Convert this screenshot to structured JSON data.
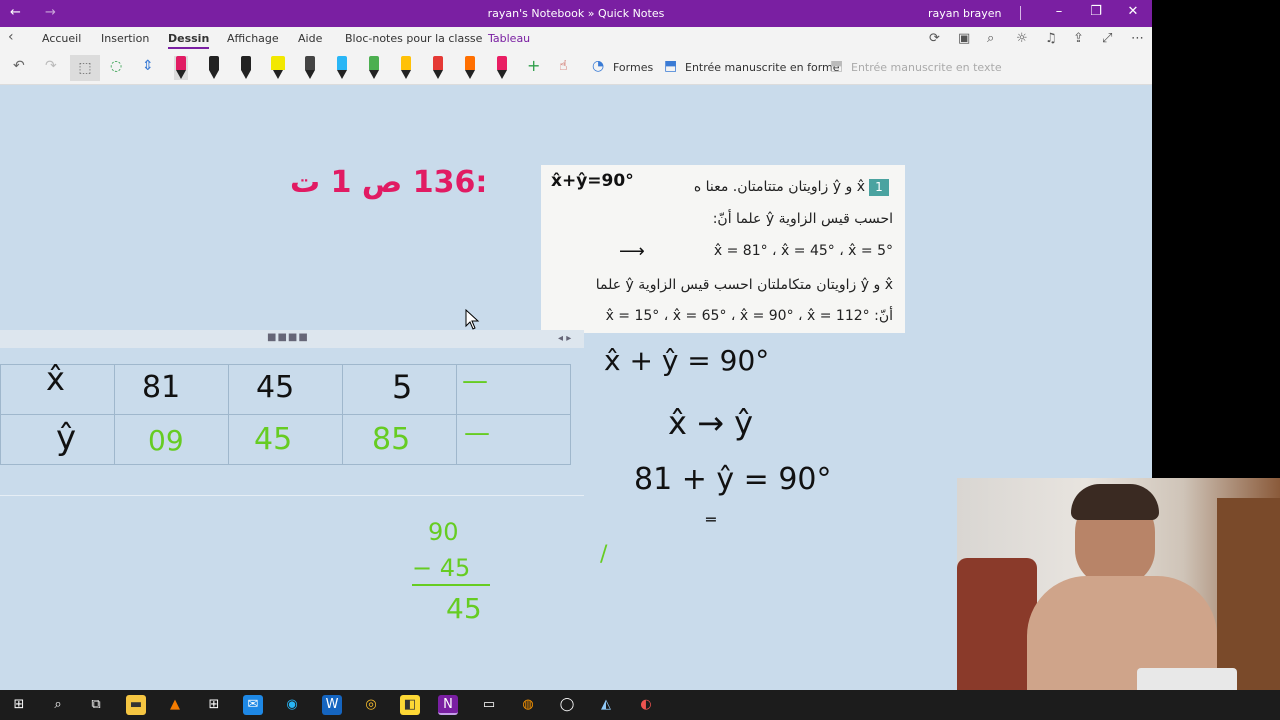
{
  "window": {
    "title": "rayan's Notebook » Quick Notes",
    "user": "rayan brayen"
  },
  "tabs": [
    "Accueil",
    "Insertion",
    "Dessin",
    "Affichage",
    "Aide",
    "Bloc-notes pour la classe",
    "Tableau"
  ],
  "active_tab": "Dessin",
  "toolbar": {
    "shapes_label": "Formes",
    "ink_to_shape_label": "Entrée manuscrite en forme",
    "ink_to_text_label": "Entrée manuscrite en texte",
    "pen_colors": [
      "#222222",
      "#222222",
      "#222222",
      "#f2e800",
      "#222222",
      "#29b6f6",
      "#4caf50",
      "#ffc107",
      "#e53935",
      "#ff6f00",
      "#e91e63"
    ]
  },
  "note": {
    "heading": ":136 ص 1 ت",
    "book": {
      "number": "1",
      "line1": "x̂ و ŷ زاويتان متتامتان. معنا ه",
      "line1_handwritten": "x̂+ŷ=90°",
      "line2": "احسب قيس الزاوية ŷ علما أنّ:",
      "line3": "x̂ = 81° ، x̂ = 45° ، x̂ = 5°",
      "line4": "x̂ و ŷ زاويتان متكاملتان احسب قيس الزاوية ŷ علما",
      "line5": "أنّ: x̂ = 15° ، x̂ = 65° ، x̂ = 90° ، x̂ = 112°"
    },
    "table": {
      "row1": [
        "x̂",
        "81",
        "45",
        "5",
        "—"
      ],
      "row2": [
        "ŷ",
        "09",
        "45",
        "85",
        "—"
      ]
    },
    "work": {
      "eq1": "x̂ + ŷ = 90°",
      "eq2": "x̂ → ŷ",
      "eq3": "81 + ŷ = 90°",
      "sub_top": "90",
      "sub_mid": "− 45",
      "sub_res": "45"
    }
  },
  "colors": {
    "titlebar": "#7a1fa2",
    "canvas": "#c9dbeb",
    "pink_ink": "#e11b63",
    "green_ink": "#66cc22"
  }
}
